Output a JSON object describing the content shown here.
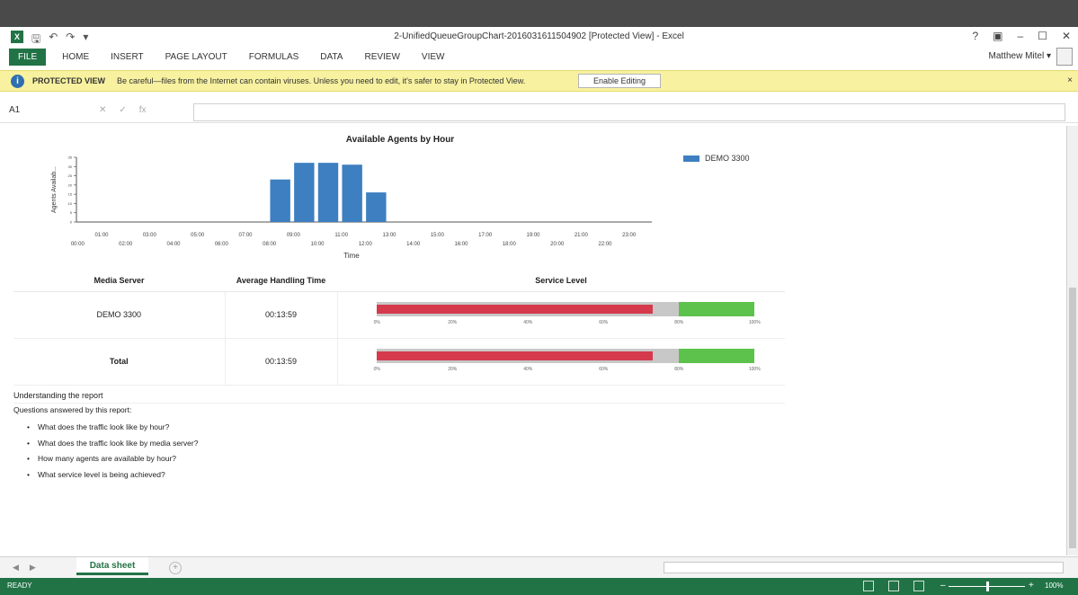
{
  "window": {
    "title": "2-UnifiedQueueGroupChart-20160316115049​02 [Protected View] - Excel",
    "controls": [
      "?",
      "▣",
      "–",
      "☐",
      "✕"
    ]
  },
  "ribbon": {
    "tabs": [
      "FILE",
      "HOME",
      "INSERT",
      "PAGE LAYOUT",
      "FORMULAS",
      "DATA",
      "REVIEW",
      "VIEW"
    ],
    "user": "Matthew Mitel ▾"
  },
  "protected_view": {
    "title": "PROTECTED VIEW",
    "message": "Be careful—files from the Internet can contain viruses. Unless you need to edit, it's safer to stay in Protected View.",
    "button": "Enable Editing",
    "close": "×"
  },
  "formula_bar": {
    "name_box": "A1",
    "fx": "fx",
    "value": ""
  },
  "chart_data": {
    "type": "bar",
    "title": "Available Agents by Hour",
    "xlabel": "Time",
    "ylabel": "Agents Availab...",
    "ylim": [
      0,
      35
    ],
    "yticks": [
      "35",
      "30",
      "25",
      "20",
      "15",
      "10",
      "5",
      "0"
    ],
    "categories": [
      "00:00",
      "01:00",
      "02:00",
      "03:00",
      "04:00",
      "05:00",
      "06:00",
      "07:00",
      "08:00",
      "09:00",
      "10:00",
      "11:00",
      "12:00",
      "13:00",
      "14:00",
      "15:00",
      "16:00",
      "17:00",
      "18:00",
      "19:00",
      "20:00",
      "21:00",
      "22:00",
      "23:00"
    ],
    "series": [
      {
        "name": "DEMO 3300",
        "values": [
          0,
          0,
          0,
          0,
          0,
          0,
          0,
          0,
          23,
          32,
          32,
          31,
          16,
          0,
          0,
          0,
          0,
          0,
          0,
          0,
          0,
          0,
          0,
          0
        ]
      }
    ],
    "legend": "top-right",
    "color": "#3d7fc1"
  },
  "table": {
    "headers": [
      "Media Server",
      "Average Handling Time",
      "Service Level"
    ],
    "rows": [
      {
        "media_server": "DEMO 3300",
        "aht": "00:13:59",
        "service_level_red": 0.73,
        "service_level_green_start": 0.8
      },
      {
        "media_server": "Total",
        "aht": "00:13:59",
        "service_level_red": 0.73,
        "service_level_green_start": 0.8
      }
    ],
    "scale_ticks": [
      "0%",
      "20%",
      "40%",
      "60%",
      "80%",
      "100%"
    ]
  },
  "notes": {
    "heading": "Understanding the report",
    "questions_heading": "Questions answered by this report:",
    "questions": [
      "What does the traffic look like by hour?",
      "What does the traffic look like by media server?",
      "How many agents are available by hour?",
      "What service level is being achieved?"
    ]
  },
  "sheet_tabs": {
    "active": "Data sheet",
    "add": "+"
  },
  "status": {
    "text": "READY",
    "zoom": "100%"
  }
}
